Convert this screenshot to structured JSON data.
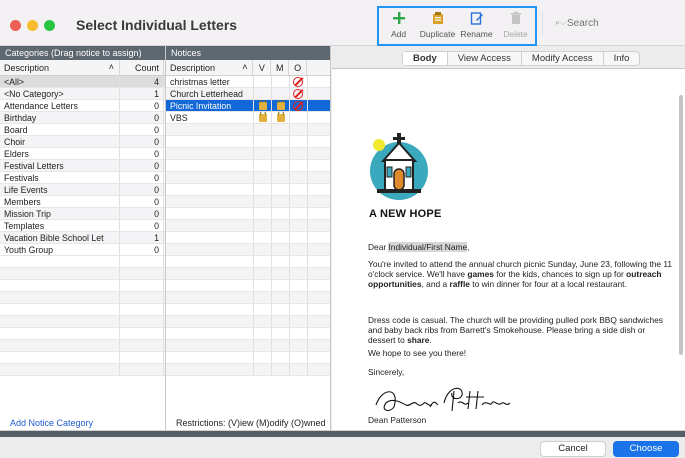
{
  "window": {
    "title": "Select Individual Letters"
  },
  "toolbar": {
    "add": "Add",
    "duplicate": "Duplicate",
    "rename": "Rename",
    "delete": "Delete"
  },
  "search": {
    "placeholder": "Search"
  },
  "categories": {
    "header": "Categories (Drag notice to assign)",
    "col_description": "Description",
    "col_count": "Count",
    "rows": [
      {
        "label": "<All>",
        "count": "4"
      },
      {
        "label": "<No Category>",
        "count": "1"
      },
      {
        "label": "Attendance Letters",
        "count": "0"
      },
      {
        "label": "Birthday",
        "count": "0"
      },
      {
        "label": "Board",
        "count": "0"
      },
      {
        "label": "Choir",
        "count": "0"
      },
      {
        "label": "Elders",
        "count": "0"
      },
      {
        "label": "Festival Letters",
        "count": "0"
      },
      {
        "label": "Festivals",
        "count": "0"
      },
      {
        "label": "Life Events",
        "count": "0"
      },
      {
        "label": "Members",
        "count": "0"
      },
      {
        "label": "Mission Trip",
        "count": "0"
      },
      {
        "label": "Templates",
        "count": "0"
      },
      {
        "label": "Vacation Bible School Let",
        "count": "1"
      },
      {
        "label": "Youth Group",
        "count": "0"
      }
    ],
    "add_link": "Add Notice Category"
  },
  "notices": {
    "header": "Notices",
    "col_description": "Description",
    "col_v": "V",
    "col_m": "M",
    "col_o": "O",
    "rows": [
      {
        "label": "christmas letter"
      },
      {
        "label": "Church Letterhead"
      },
      {
        "label": "Picnic Invitation"
      },
      {
        "label": "VBS"
      }
    ],
    "restrictions": "Restrictions: (V)iew (M)odify (O)wned"
  },
  "preview": {
    "tabs": [
      "Body",
      "View Access",
      "Modify Access",
      "Info"
    ],
    "logo_text": "A NEW HOPE",
    "greeting_prefix": "Dear ",
    "greeting_field": "Individual/First Name",
    "greeting_suffix": ",",
    "p1_a": "You're invited to attend the annual church picnic Sunday, June 23, following the 11 o'clock service. We'll have ",
    "p1_b": "games",
    "p1_c": " for the kids, chances to sign up for ",
    "p1_d": "outreach opportunities",
    "p1_e": ", and a ",
    "p1_f": "raffle",
    "p1_g": " to win dinner for four at a local restaurant.",
    "p2_a": "Dress code is casual. The church will be providing pulled pork BBQ sandwiches and baby back ribs from Barrett's Smokehouse. Please bring a side dish or dessert to ",
    "p2_b": "share",
    "p2_c": ".",
    "p3": "We hope to see you there!",
    "p4": "Sincerely,",
    "signer": "Dean Patterson"
  },
  "buttons": {
    "cancel": "Cancel",
    "choose": "Choose"
  }
}
